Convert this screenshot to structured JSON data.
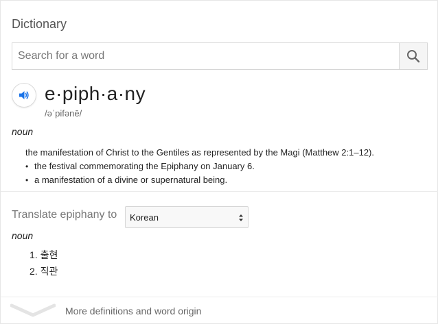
{
  "header": {
    "title": "Dictionary"
  },
  "search": {
    "placeholder": "Search for a word",
    "value": ""
  },
  "entry": {
    "word": "e·piph·a·ny",
    "phonetic": "/əˈpifənē/",
    "part_of_speech": "noun",
    "definitions": {
      "main": "the manifestation of Christ to the Gentiles as represented by the Magi (Matthew 2:1–12).",
      "subs": [
        "the festival commemorating the Epiphany on January 6.",
        "a manifestation of a divine or supernatural being."
      ]
    }
  },
  "translate": {
    "label": "Translate epiphany to",
    "selected_language": "Korean",
    "part_of_speech": "noun",
    "items": [
      "1. 출현",
      "2. 직관"
    ]
  },
  "footer": {
    "more_label": "More definitions and word origin"
  },
  "colors": {
    "accent_blue": "#1a73e8",
    "icon_gray": "#666666"
  }
}
